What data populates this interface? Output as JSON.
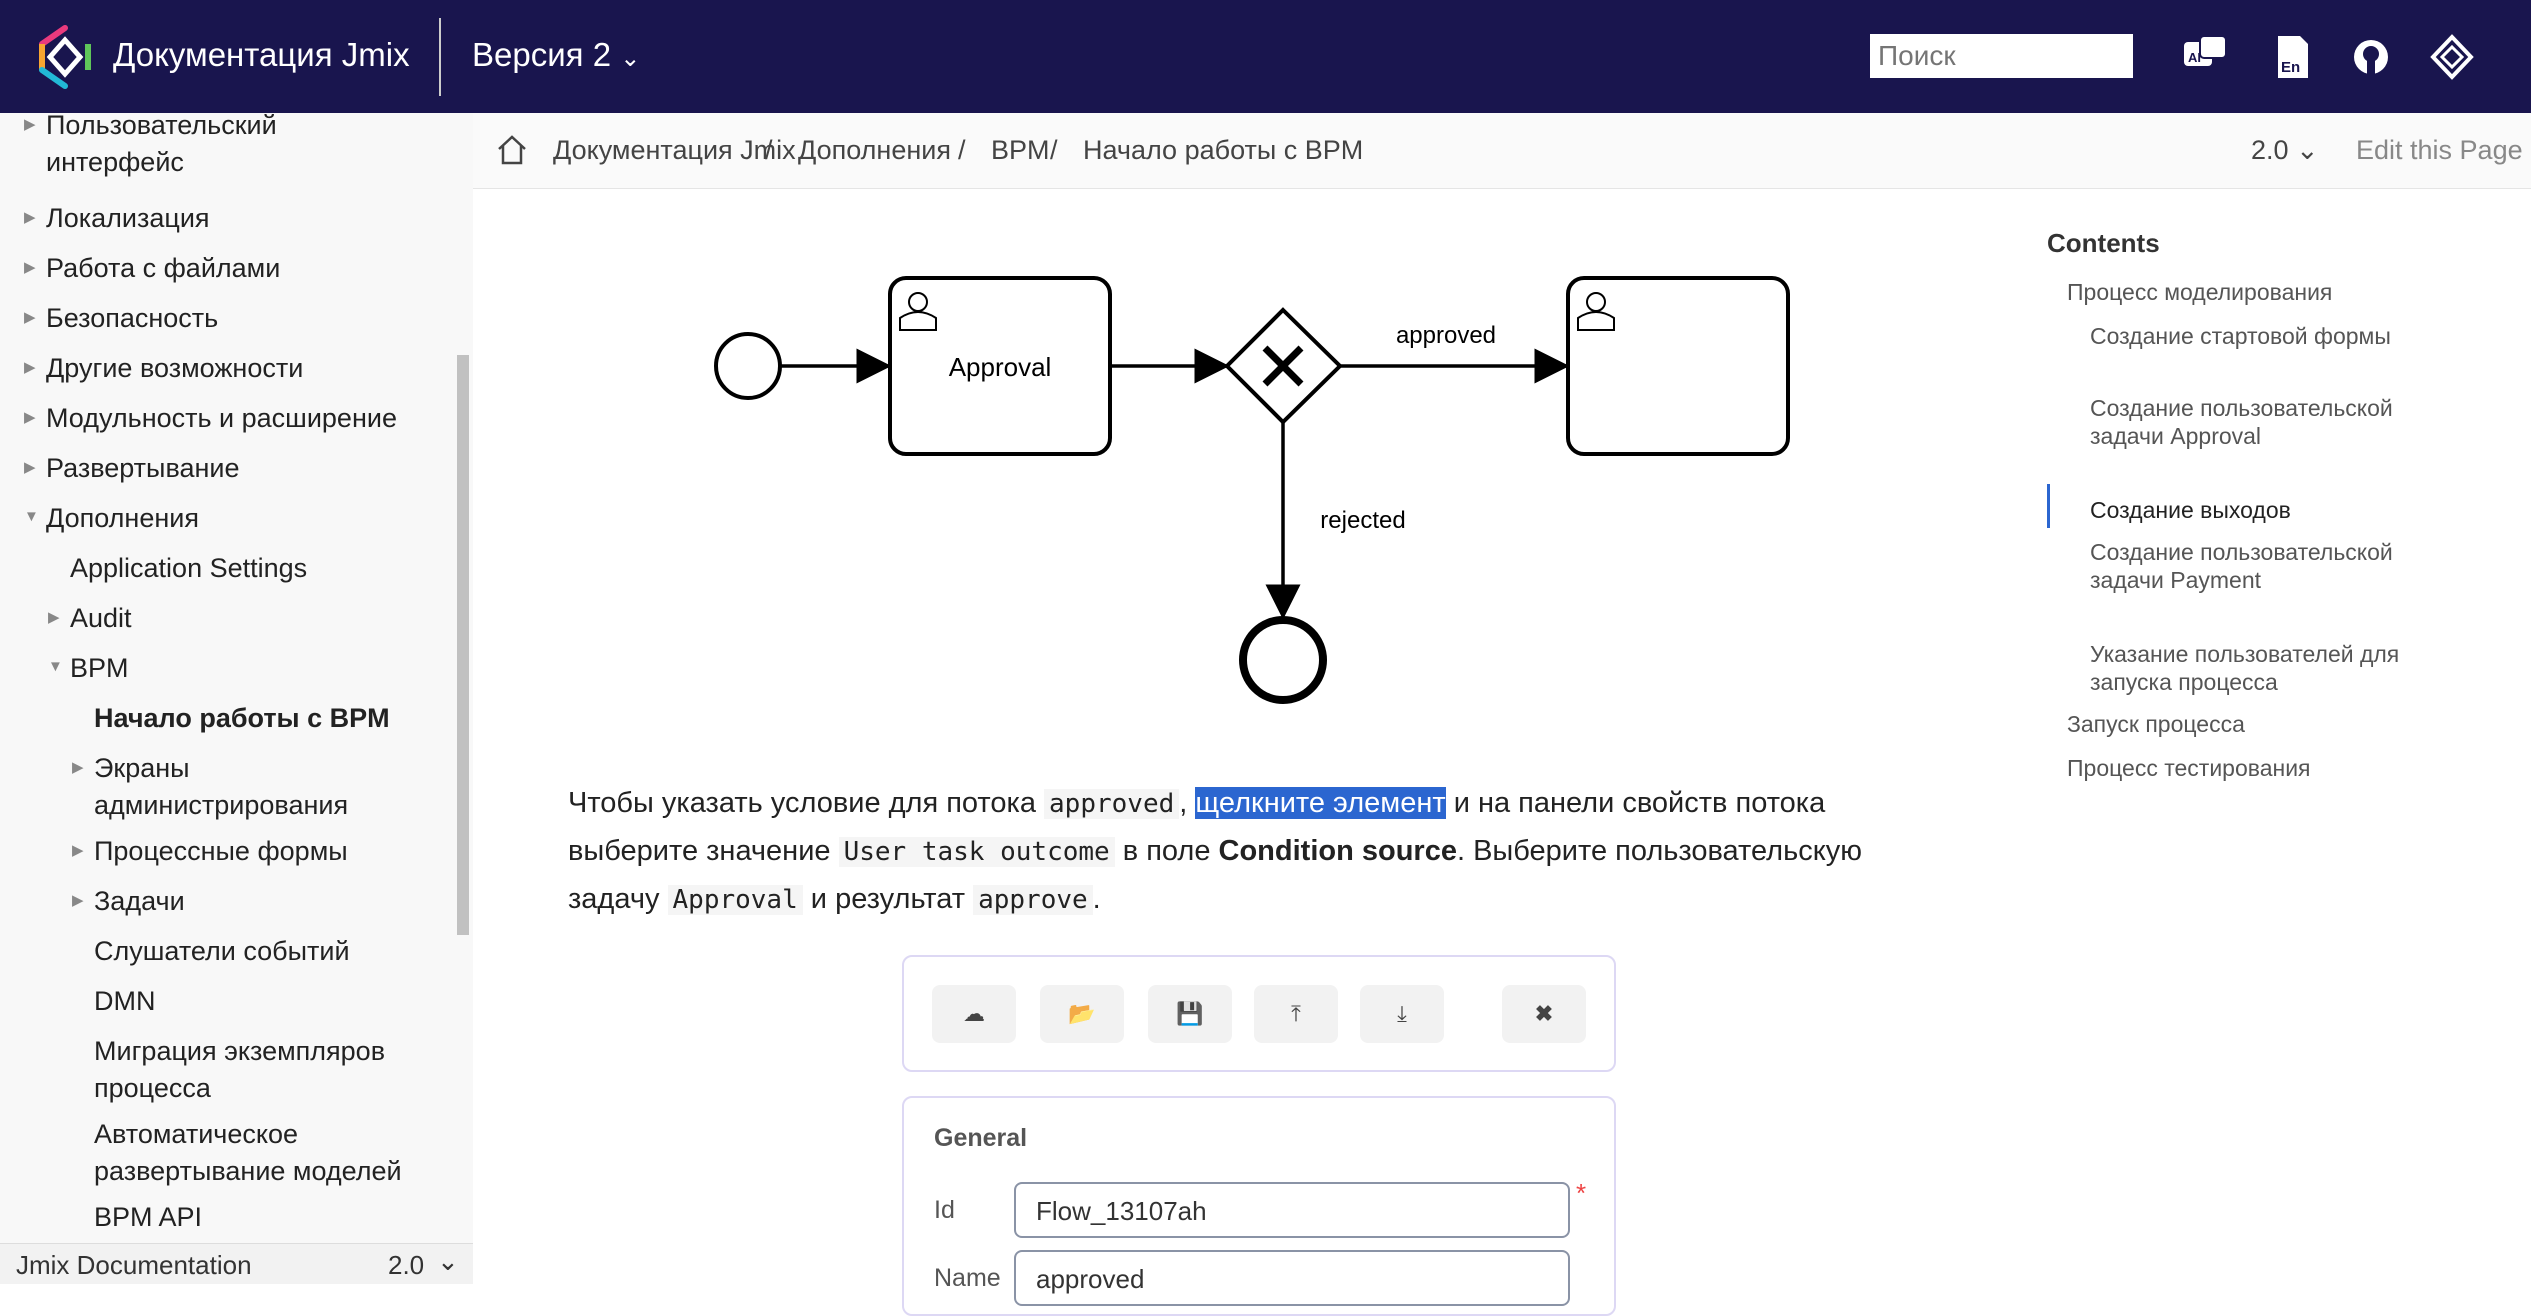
{
  "header": {
    "brand": "Документация Jmix",
    "version": "Версия 2",
    "search_placeholder": "Поиск",
    "icons": [
      "ai-chat-icon",
      "english-language-icon",
      "github-icon",
      "jmix-logo-icon"
    ]
  },
  "sidebar": {
    "items": [
      {
        "label": "Пользовательский интерфейс",
        "level": 0,
        "arrow": "right"
      },
      {
        "label": "Локализация",
        "level": 0,
        "arrow": "right"
      },
      {
        "label": "Работа с файлами",
        "level": 0,
        "arrow": "right"
      },
      {
        "label": "Безопасность",
        "level": 0,
        "arrow": "right"
      },
      {
        "label": "Другие возможности",
        "level": 0,
        "arrow": "right"
      },
      {
        "label": "Модульность и расширение",
        "level": 0,
        "arrow": "right"
      },
      {
        "label": "Развертывание",
        "level": 0,
        "arrow": "right"
      },
      {
        "label": "Дополнения",
        "level": 0,
        "arrow": "down"
      },
      {
        "label": "Application Settings",
        "level": 1,
        "arrow": ""
      },
      {
        "label": "Audit",
        "level": 1,
        "arrow": "right"
      },
      {
        "label": "BPM",
        "level": 1,
        "arrow": "down"
      },
      {
        "label": "Начало работы с BPM",
        "level": 2,
        "arrow": "",
        "active": true
      },
      {
        "label": "Экраны администрирования",
        "level": 2,
        "arrow": "right"
      },
      {
        "label": "Процессные формы",
        "level": 2,
        "arrow": "right"
      },
      {
        "label": "Задачи",
        "level": 2,
        "arrow": "right"
      },
      {
        "label": "Слушатели событий",
        "level": 2,
        "arrow": ""
      },
      {
        "label": "DMN",
        "level": 2,
        "arrow": ""
      },
      {
        "label": "Миграция экземпляров процесса",
        "level": 2,
        "arrow": ""
      },
      {
        "label": "Автоматическое развертывание моделей",
        "level": 2,
        "arrow": ""
      },
      {
        "label": "BPM API",
        "level": 2,
        "arrow": ""
      }
    ],
    "footer_title": "Jmix Documentation",
    "footer_version": "2.0"
  },
  "breadcrumb": [
    "Документация Jmix",
    "Дополнения",
    "BPM",
    "Начало работы с BPM"
  ],
  "page_version": "2.0",
  "edit_link": "Edit this Page",
  "diagram": {
    "task1": "Approval",
    "flow_approved": "approved",
    "flow_rejected": "rejected"
  },
  "paragraph": {
    "t1": "Чтобы указать условие для потока ",
    "c1": "approved",
    "t2": ", ",
    "hl": "щелкните элемент",
    "t3": " и на панели свойств потока выберите значение ",
    "c2": "User task outcome",
    "t4": " в поле ",
    "b1": "Condition source",
    "t5": ". Выберите пользовательскую задачу ",
    "c3": "Approval",
    "t6": " и результат ",
    "c4": "approve",
    "t7": "."
  },
  "toc": {
    "title": "Contents",
    "items": [
      {
        "label": "Процесс моделирования",
        "level": 0
      },
      {
        "label": "Создание стартовой формы",
        "level": 1
      },
      {
        "label": "Создание пользовательской задачи Approval",
        "level": 1
      },
      {
        "label": "Создание выходов",
        "level": 1,
        "active": true
      },
      {
        "label": "Создание пользовательской задачи Payment",
        "level": 1
      },
      {
        "label": "Указание пользователей для запуска процесса",
        "level": 1
      },
      {
        "label": "Запуск процесса",
        "level": 0
      },
      {
        "label": "Процесс тестирования",
        "level": 0
      }
    ]
  },
  "modeler": {
    "toolbar": [
      "cloud-upload-icon",
      "folder-open-icon",
      "save-icon",
      "export-icon",
      "import-icon",
      "close-icon"
    ],
    "section": "General",
    "id_label": "Id",
    "id_value": "Flow_13107ah",
    "name_label": "Name",
    "name_value": "approved",
    "required_mark": "*"
  }
}
